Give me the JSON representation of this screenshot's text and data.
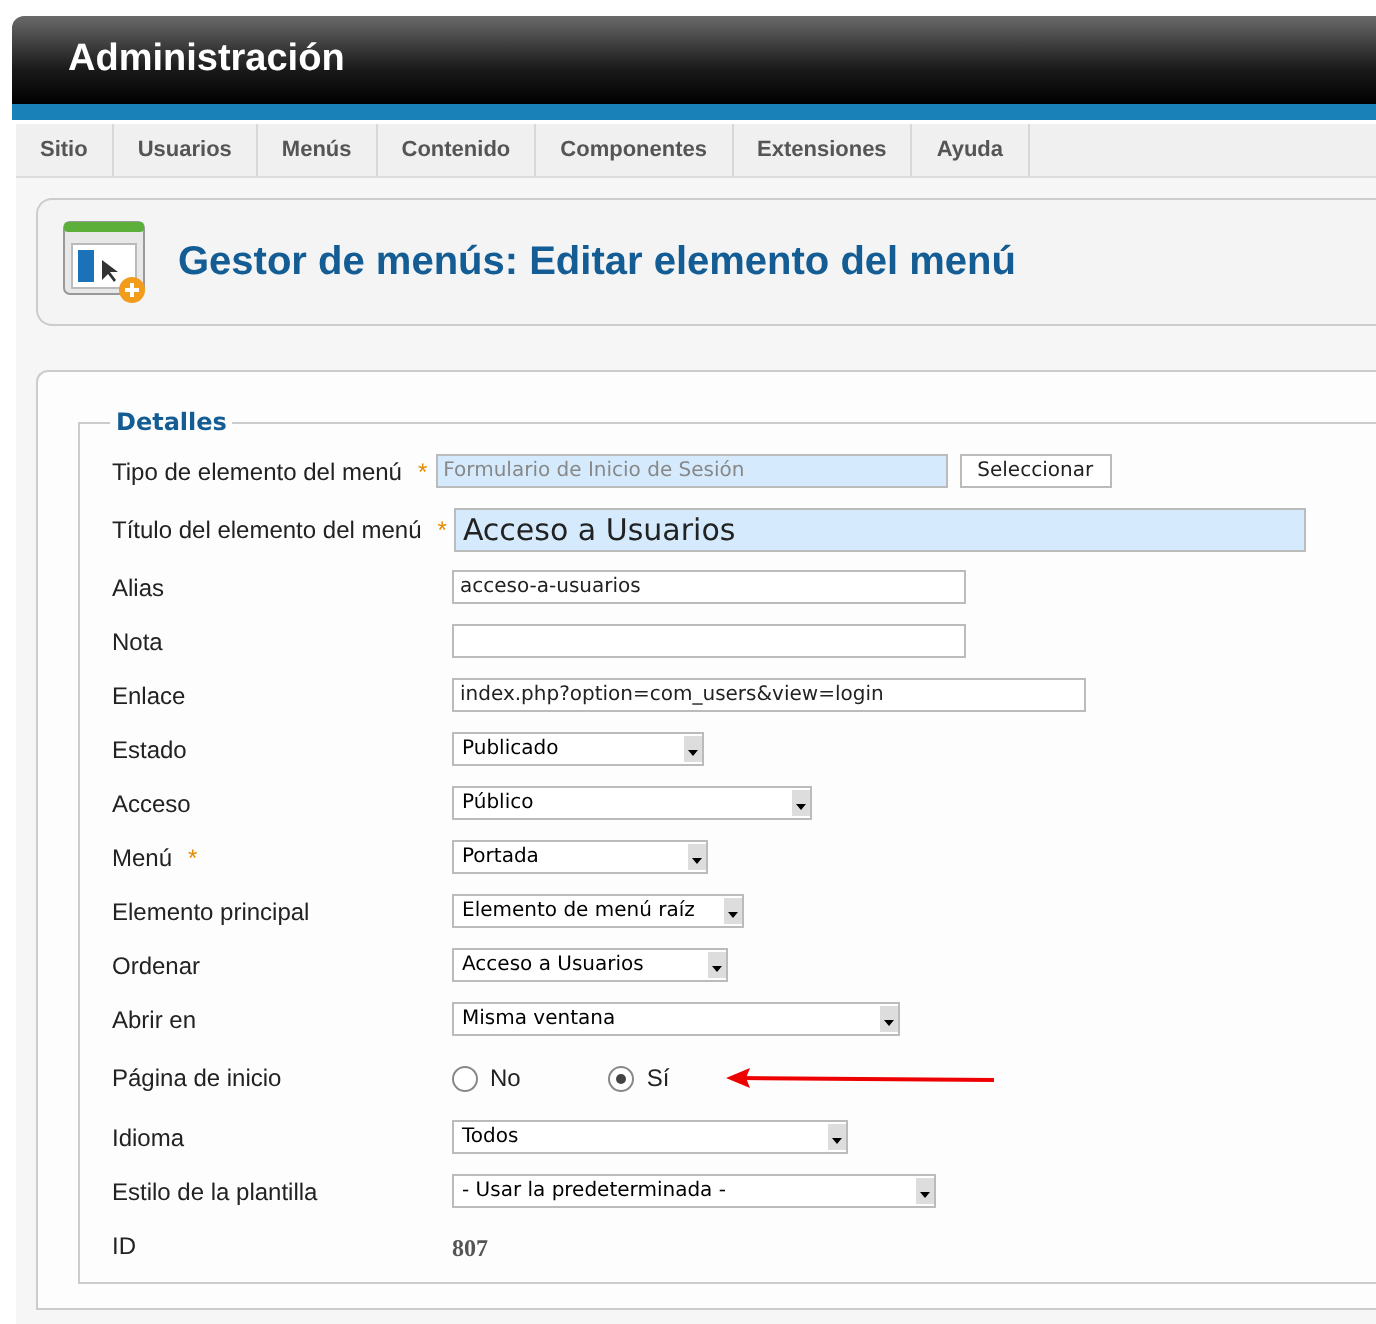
{
  "header": {
    "title": "Administración"
  },
  "menu": [
    {
      "label": "Sitio"
    },
    {
      "label": "Usuarios"
    },
    {
      "label": "Menús"
    },
    {
      "label": "Contenido"
    },
    {
      "label": "Componentes"
    },
    {
      "label": "Extensiones"
    },
    {
      "label": "Ayuda"
    }
  ],
  "page_title": "Gestor de menús: Editar elemento del menú",
  "details": {
    "legend": "Detalles",
    "fields": [
      {
        "kind": "picker",
        "label": "Tipo de elemento del menú",
        "required_mark": "*",
        "value": "Formulario de Inicio de Sesión",
        "button": "Seleccionar"
      },
      {
        "kind": "large",
        "label": "Título del elemento del menú",
        "required_mark": "*",
        "value": "Acceso a Usuarios"
      },
      {
        "kind": "text",
        "label": "Alias",
        "value": "acceso-a-usuarios"
      },
      {
        "kind": "text",
        "label": "Nota"
      },
      {
        "kind": "text",
        "label": "Enlace",
        "value": "index.php?option=com_users&view=login"
      },
      {
        "kind": "select",
        "label": "Estado",
        "value": "Publicado"
      },
      {
        "kind": "select",
        "label": "Acceso",
        "value": "Público"
      },
      {
        "kind": "select",
        "label": "Menú",
        "required_mark": "*",
        "value": "Portada"
      },
      {
        "kind": "select",
        "label": "Elemento principal",
        "value": "Elemento de menú raíz"
      },
      {
        "kind": "select",
        "label": "Ordenar",
        "value": "Acceso a Usuarios"
      },
      {
        "kind": "select",
        "label": "Abrir en",
        "value": "Misma ventana"
      },
      {
        "kind": "radio",
        "label": "Página de inicio",
        "options": [
          {
            "label": "No",
            "selected": false
          },
          {
            "label": "Sí",
            "selected": true
          }
        ]
      },
      {
        "kind": "select",
        "label": "Idioma",
        "value": "Todos"
      },
      {
        "kind": "select",
        "label": "Estilo de la plantilla",
        "value": "- Usar la predeterminada -"
      },
      {
        "kind": "static",
        "label": "ID",
        "value": "807"
      }
    ]
  }
}
